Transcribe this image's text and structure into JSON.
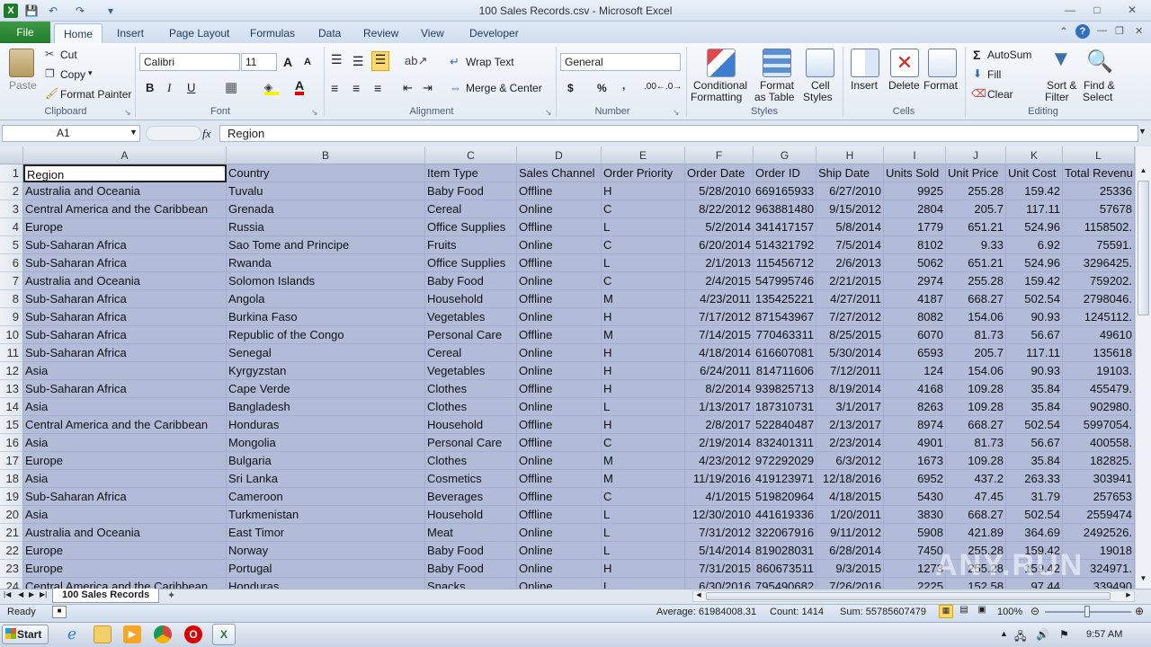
{
  "window": {
    "title": "100 Sales Records.csv - Microsoft Excel"
  },
  "quick_access": {
    "save_icon": "save-icon",
    "undo_icon": "undo-icon",
    "redo_icon": "redo-icon"
  },
  "ribbon_tabs": [
    "Home",
    "Insert",
    "Page Layout",
    "Formulas",
    "Data",
    "Review",
    "View",
    "Developer"
  ],
  "file_tab": "File",
  "clipboard": {
    "paste": "Paste",
    "cut": "Cut",
    "copy": "Copy",
    "format_painter": "Format Painter",
    "group": "Clipboard"
  },
  "font": {
    "name": "Calibri",
    "size": "11",
    "group": "Font"
  },
  "alignment": {
    "wrap_text": "Wrap Text",
    "merge_center": "Merge & Center",
    "group": "Alignment"
  },
  "number": {
    "format": "General",
    "currency": "$",
    "percent": "%",
    "comma": ",",
    "group": "Number"
  },
  "styles": {
    "conditional": "Conditional",
    "conditional2": "Formatting",
    "format_table": "Format",
    "format_table2": "as Table",
    "cell_styles": "Cell",
    "cell_styles2": "Styles",
    "group": "Styles"
  },
  "cells": {
    "insert": "Insert",
    "delete": "Delete",
    "format": "Format",
    "group": "Cells"
  },
  "editing": {
    "autosum": "AutoSum",
    "fill": "Fill",
    "clear": "Clear",
    "sort_filter": "Sort &",
    "sort_filter2": "Filter",
    "find_select": "Find &",
    "find_select2": "Select",
    "group": "Editing"
  },
  "formula_bar": {
    "name_box": "A1",
    "fx": "fx",
    "content": "Region"
  },
  "columns": [
    {
      "letter": "A"
    },
    {
      "letter": "B"
    },
    {
      "letter": "C"
    },
    {
      "letter": "D"
    },
    {
      "letter": "E"
    },
    {
      "letter": "F"
    },
    {
      "letter": "G"
    },
    {
      "letter": "H"
    },
    {
      "letter": "I"
    },
    {
      "letter": "J"
    },
    {
      "letter": "K"
    },
    {
      "letter": "L"
    }
  ],
  "header_row": [
    "Region",
    "Country",
    "Item Type",
    "Sales Channel",
    "Order Priority",
    "Order Date",
    "Order ID",
    "Ship Date",
    "Units Sold",
    "Unit Price",
    "Unit Cost",
    "Total Revenu"
  ],
  "rows": [
    [
      "Australia and Oceania",
      "Tuvalu",
      "Baby Food",
      "Offline",
      "H",
      "5/28/2010",
      "669165933",
      "6/27/2010",
      "9925",
      "255.28",
      "159.42",
      "25336"
    ],
    [
      "Central America and the Caribbean",
      "Grenada",
      "Cereal",
      "Online",
      "C",
      "8/22/2012",
      "963881480",
      "9/15/2012",
      "2804",
      "205.7",
      "117.11",
      "57678"
    ],
    [
      "Europe",
      "Russia",
      "Office Supplies",
      "Offline",
      "L",
      "5/2/2014",
      "341417157",
      "5/8/2014",
      "1779",
      "651.21",
      "524.96",
      "1158502."
    ],
    [
      "Sub-Saharan Africa",
      "Sao Tome and Principe",
      "Fruits",
      "Online",
      "C",
      "6/20/2014",
      "514321792",
      "7/5/2014",
      "8102",
      "9.33",
      "6.92",
      "75591."
    ],
    [
      "Sub-Saharan Africa",
      "Rwanda",
      "Office Supplies",
      "Offline",
      "L",
      "2/1/2013",
      "115456712",
      "2/6/2013",
      "5062",
      "651.21",
      "524.96",
      "3296425."
    ],
    [
      "Australia and Oceania",
      "Solomon Islands",
      "Baby Food",
      "Online",
      "C",
      "2/4/2015",
      "547995746",
      "2/21/2015",
      "2974",
      "255.28",
      "159.42",
      "759202."
    ],
    [
      "Sub-Saharan Africa",
      "Angola",
      "Household",
      "Offline",
      "M",
      "4/23/2011",
      "135425221",
      "4/27/2011",
      "4187",
      "668.27",
      "502.54",
      "2798046."
    ],
    [
      "Sub-Saharan Africa",
      "Burkina Faso",
      "Vegetables",
      "Online",
      "H",
      "7/17/2012",
      "871543967",
      "7/27/2012",
      "8082",
      "154.06",
      "90.93",
      "1245112."
    ],
    [
      "Sub-Saharan Africa",
      "Republic of the Congo",
      "Personal Care",
      "Offline",
      "M",
      "7/14/2015",
      "770463311",
      "8/25/2015",
      "6070",
      "81.73",
      "56.67",
      "49610"
    ],
    [
      "Sub-Saharan Africa",
      "Senegal",
      "Cereal",
      "Online",
      "H",
      "4/18/2014",
      "616607081",
      "5/30/2014",
      "6593",
      "205.7",
      "117.11",
      "135618"
    ],
    [
      "Asia",
      "Kyrgyzstan",
      "Vegetables",
      "Online",
      "H",
      "6/24/2011",
      "814711606",
      "7/12/2011",
      "124",
      "154.06",
      "90.93",
      "19103."
    ],
    [
      "Sub-Saharan Africa",
      "Cape Verde",
      "Clothes",
      "Offline",
      "H",
      "8/2/2014",
      "939825713",
      "8/19/2014",
      "4168",
      "109.28",
      "35.84",
      "455479."
    ],
    [
      "Asia",
      "Bangladesh",
      "Clothes",
      "Online",
      "L",
      "1/13/2017",
      "187310731",
      "3/1/2017",
      "8263",
      "109.28",
      "35.84",
      "902980."
    ],
    [
      "Central America and the Caribbean",
      "Honduras",
      "Household",
      "Offline",
      "H",
      "2/8/2017",
      "522840487",
      "2/13/2017",
      "8974",
      "668.27",
      "502.54",
      "5997054."
    ],
    [
      "Asia",
      "Mongolia",
      "Personal Care",
      "Offline",
      "C",
      "2/19/2014",
      "832401311",
      "2/23/2014",
      "4901",
      "81.73",
      "56.67",
      "400558."
    ],
    [
      "Europe",
      "Bulgaria",
      "Clothes",
      "Online",
      "M",
      "4/23/2012",
      "972292029",
      "6/3/2012",
      "1673",
      "109.28",
      "35.84",
      "182825."
    ],
    [
      "Asia",
      "Sri Lanka",
      "Cosmetics",
      "Offline",
      "M",
      "11/19/2016",
      "419123971",
      "12/18/2016",
      "6952",
      "437.2",
      "263.33",
      "303941"
    ],
    [
      "Sub-Saharan Africa",
      "Cameroon",
      "Beverages",
      "Offline",
      "C",
      "4/1/2015",
      "519820964",
      "4/18/2015",
      "5430",
      "47.45",
      "31.79",
      "257653"
    ],
    [
      "Asia",
      "Turkmenistan",
      "Household",
      "Offline",
      "L",
      "12/30/2010",
      "441619336",
      "1/20/2011",
      "3830",
      "668.27",
      "502.54",
      "2559474"
    ],
    [
      "Australia and Oceania",
      "East Timor",
      "Meat",
      "Online",
      "L",
      "7/31/2012",
      "322067916",
      "9/11/2012",
      "5908",
      "421.89",
      "364.69",
      "2492526."
    ],
    [
      "Europe",
      "Norway",
      "Baby Food",
      "Online",
      "L",
      "5/14/2014",
      "819028031",
      "6/28/2014",
      "7450",
      "255.28",
      "159.42",
      "19018"
    ],
    [
      "Europe",
      "Portugal",
      "Baby Food",
      "Online",
      "H",
      "7/31/2015",
      "860673511",
      "9/3/2015",
      "1273",
      "255.28",
      "159.42",
      "324971."
    ],
    [
      "Central America and the Caribbean",
      "Honduras",
      "Snacks",
      "Online",
      "L",
      "6/30/2016",
      "795490682",
      "7/26/2016",
      "2225",
      "152.58",
      "97.44",
      "339490"
    ]
  ],
  "sheet_tab": "100 Sales Records",
  "status": {
    "ready": "Ready",
    "average": "Average: 61984008.31",
    "count": "Count: 1414",
    "sum": "Sum: 55785607479",
    "zoom": "100%"
  },
  "taskbar": {
    "start": "Start",
    "time": "9:57 AM"
  },
  "watermark": "ANY.RUN"
}
